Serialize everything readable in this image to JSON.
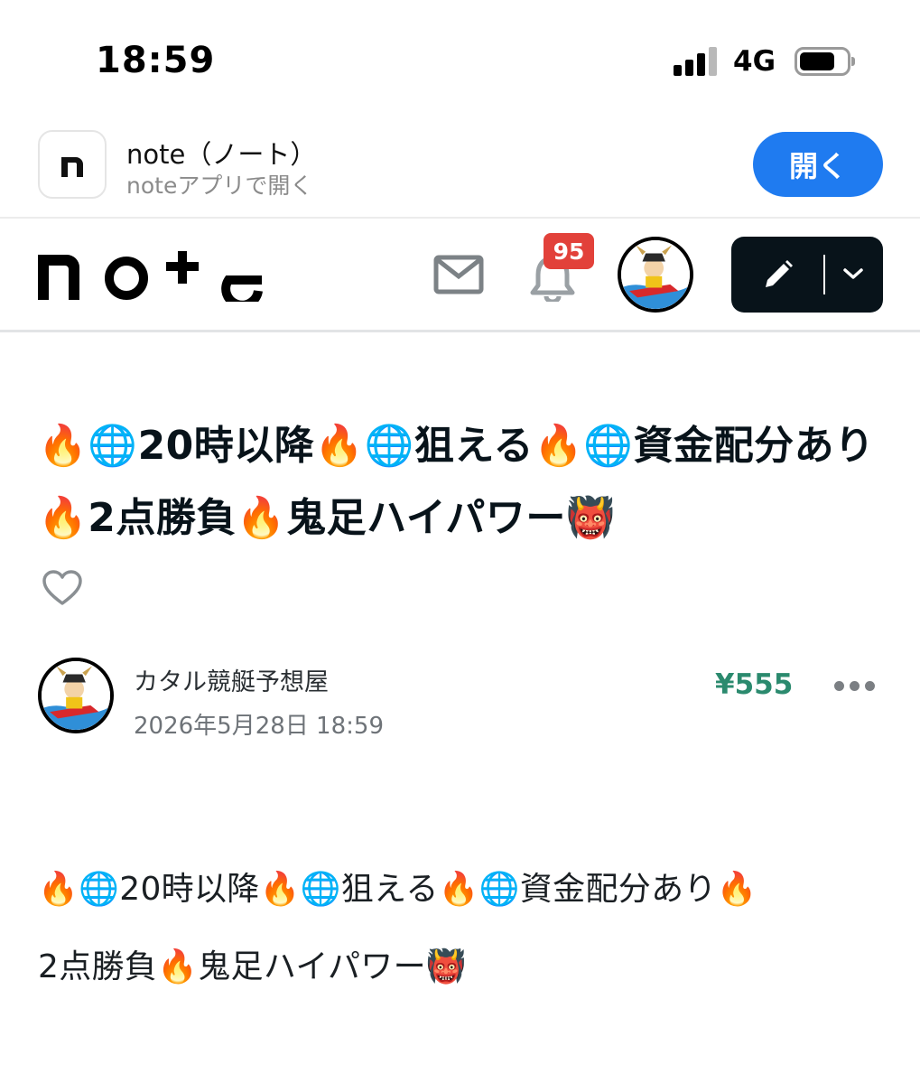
{
  "status_bar": {
    "time": "18:59",
    "network": "4G"
  },
  "app_banner": {
    "app_name": "note（ノート）",
    "subtitle": "noteアプリで開く",
    "open_label": "開く"
  },
  "header": {
    "logo": "note",
    "notification_count": "95"
  },
  "article": {
    "title": "🔥🌐20時以降🔥🌐狙える🔥🌐資金配分あり🔥2点勝負🔥鬼足ハイパワー👹",
    "author": "カタル競艇予想屋",
    "date": "2026年5月28日 18:59",
    "price": "¥555",
    "body_line1": "🔥🌐20時以降🔥🌐狙える🔥🌐資金配分あり🔥",
    "body_line2": "2点勝負🔥鬼足ハイパワー👹"
  },
  "colors": {
    "open_button": "#1f7bf0",
    "badge": "#e2413a",
    "price": "#2b8a6e",
    "post_button": "#08131a"
  },
  "icons": [
    "app-icon",
    "mail-icon",
    "bell-icon",
    "pencil-icon",
    "chevron-down-icon",
    "heart-icon",
    "more-icon"
  ]
}
